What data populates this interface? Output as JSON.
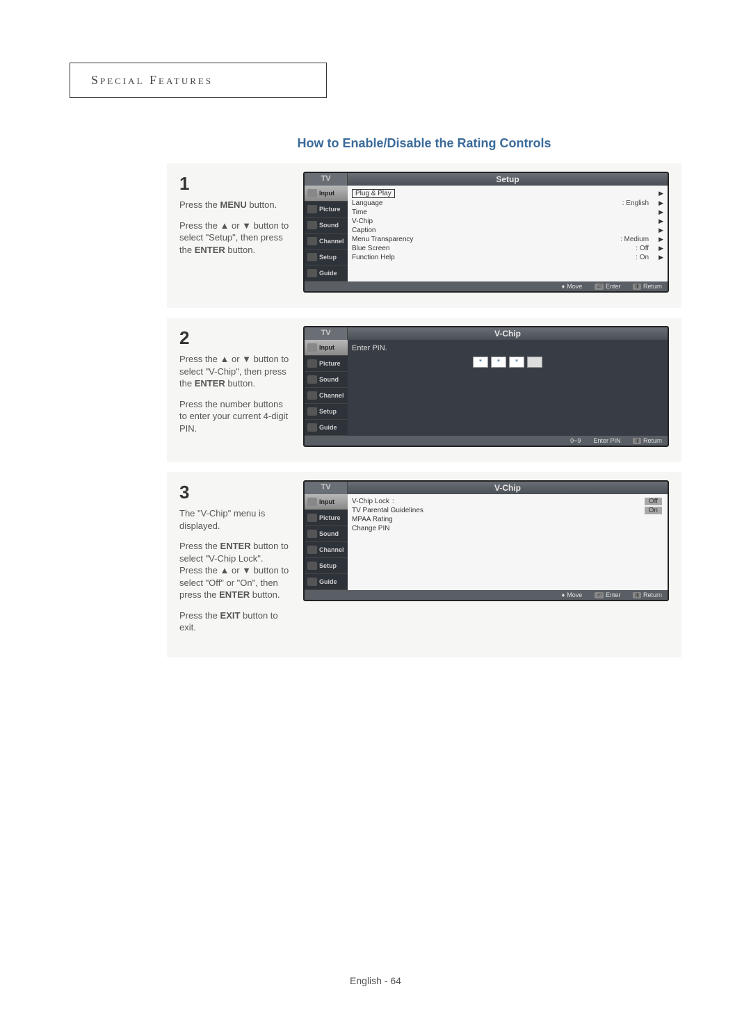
{
  "chapter": "Special Features",
  "title": "How to Enable/Disable the Rating Controls",
  "sidebar": [
    "Input",
    "Picture",
    "Sound",
    "Channel",
    "Setup",
    "Guide"
  ],
  "step1": {
    "num": "1",
    "p1_a": "Press the ",
    "p1_b": "MENU",
    "p1_c": " button.",
    "p2": "Press the ▲ or ▼ button to select \"Setup\", then press the ",
    "p2_b": "ENTER",
    "p2_c": " button.",
    "osd": {
      "tv": "TV",
      "title": "Setup",
      "rows": [
        {
          "label": "Plug & Play",
          "value": "",
          "boxed": true
        },
        {
          "label": "Language",
          "value": ": English"
        },
        {
          "label": "Time",
          "value": ""
        },
        {
          "label": "V-Chip",
          "value": ""
        },
        {
          "label": "Caption",
          "value": ""
        },
        {
          "label": "Menu Transparency",
          "value": ": Medium"
        },
        {
          "label": "Blue Screen",
          "value": ": Off"
        },
        {
          "label": "Function Help",
          "value": ": On"
        }
      ],
      "footer": {
        "a": "Move",
        "b": "Enter",
        "c": "Return"
      }
    }
  },
  "step2": {
    "num": "2",
    "p1": "Press the ▲ or ▼ button to select \"V-Chip\", then press the ",
    "p1_b": "ENTER",
    "p1_c": " button.",
    "p2": "Press the number buttons to enter your current 4-digit PIN.",
    "osd": {
      "tv": "TV",
      "title": "V-Chip",
      "label": "Enter PIN.",
      "pins": [
        "*",
        "*",
        "*",
        ""
      ],
      "footer": {
        "a": "0~9",
        "b": "Enter PIN",
        "c": "Return"
      }
    }
  },
  "step3": {
    "num": "3",
    "p1": "The \"V-Chip\" menu is displayed.",
    "p2_a": "Press the ",
    "p2_b": "ENTER",
    "p2_c": " button to select \"V-Chip Lock\".",
    "p3": "Press the ▲ or ▼ button to select \"Off\" or \"On\", then press the ",
    "p3_b": "ENTER",
    "p3_c": " button.",
    "p4_a": "Press the ",
    "p4_b": "EXIT",
    "p4_c": " button to exit.",
    "osd": {
      "tv": "TV",
      "title": "V-Chip",
      "rows": [
        {
          "label": "V-Chip Lock",
          "sep": ":",
          "vbox": "Off"
        },
        {
          "label": "TV Parental Guidelines",
          "sep": "",
          "vbox": "On"
        },
        {
          "label": "MPAA Rating",
          "sep": "",
          "vbox": ""
        },
        {
          "label": "Change PIN",
          "sep": "",
          "vbox": ""
        }
      ],
      "footer": {
        "a": "Move",
        "b": "Enter",
        "c": "Return"
      }
    }
  },
  "footer": "English - 64"
}
